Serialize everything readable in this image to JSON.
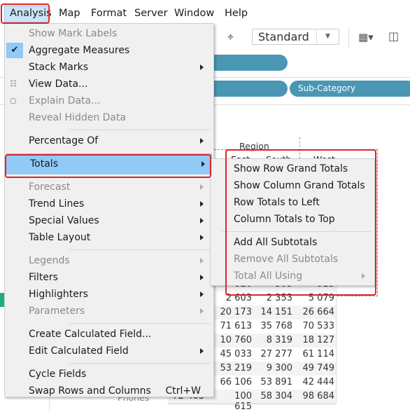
{
  "menubar": {
    "items": [
      "Analysis",
      "Map",
      "Format",
      "Server",
      "Window",
      "Help"
    ],
    "active": "Analysis"
  },
  "toolbar": {
    "fit_select": "Standard",
    "icons": [
      "pin-icon",
      "show-me-icon",
      "presentation-icon"
    ]
  },
  "shelves": {
    "pill_label": "Sub-Category"
  },
  "table": {
    "column_header": "Region",
    "columns": [
      "East",
      "South",
      "West"
    ],
    "last_row_label": "Phones",
    "rows": [
      [
        "",
        "820",
        "303",
        "923"
      ],
      [
        "",
        "2 603",
        "2 353",
        "5 079"
      ],
      [
        "",
        "20 173",
        "14 151",
        "26 664"
      ],
      [
        "",
        "71 613",
        "35 768",
        "70 533"
      ],
      [
        "",
        "10 760",
        "8 319",
        "18 127"
      ],
      [
        "",
        "45 033",
        "27 277",
        "61 114"
      ],
      [
        "",
        "53 219",
        "9 300",
        "49 749"
      ],
      [
        "",
        "66 106",
        "53 891",
        "42 444"
      ],
      [
        "72 403",
        "100 615",
        "58 304",
        "98 684"
      ]
    ]
  },
  "analysis_menu": {
    "items": [
      {
        "label": "Show Mark Labels",
        "disabled": true
      },
      {
        "label": "Aggregate Measures",
        "checked": true
      },
      {
        "label": "Stack Marks",
        "submenu": true
      },
      {
        "label": "View Data...",
        "icon": "table-icon"
      },
      {
        "label": "Explain Data...",
        "disabled": true,
        "icon": "lightbulb-icon"
      },
      {
        "label": "Reveal Hidden Data",
        "disabled": true
      },
      {
        "separator": true
      },
      {
        "label": "Percentage Of",
        "submenu": true
      },
      {
        "label": "Totals",
        "submenu": true,
        "highlighted": true
      },
      {
        "label": "Forecast",
        "submenu": true,
        "disabled": true
      },
      {
        "label": "Trend Lines",
        "submenu": true
      },
      {
        "label": "Special Values",
        "submenu": true
      },
      {
        "label": "Table Layout",
        "submenu": true
      },
      {
        "separator": true
      },
      {
        "label": "Legends",
        "submenu": true,
        "disabled": true
      },
      {
        "label": "Filters",
        "submenu": true
      },
      {
        "label": "Highlighters",
        "submenu": true
      },
      {
        "label": "Parameters",
        "submenu": true,
        "disabled": true
      },
      {
        "separator": true
      },
      {
        "label": "Create Calculated Field..."
      },
      {
        "label": "Edit Calculated Field",
        "submenu": true
      },
      {
        "separator": true
      },
      {
        "label": "Cycle Fields"
      },
      {
        "label": "Swap Rows and Columns",
        "shortcut": "Ctrl+W"
      }
    ]
  },
  "totals_submenu": {
    "items": [
      {
        "label": "Show Row Grand Totals"
      },
      {
        "label": "Show Column Grand Totals"
      },
      {
        "label": "Row Totals to Left"
      },
      {
        "label": "Column Totals to Top"
      },
      {
        "separator": true
      },
      {
        "label": "Add All Subtotals"
      },
      {
        "label": "Remove All Subtotals",
        "disabled": true
      },
      {
        "label": "Total All Using",
        "submenu": true,
        "disabled": true
      }
    ]
  },
  "colors": {
    "highlight": "#91c9f7",
    "annotation": "#e0222a",
    "pill": "#4a97b4"
  }
}
